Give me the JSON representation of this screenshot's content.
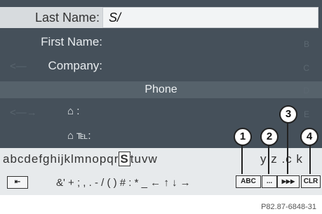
{
  "form": {
    "last_name_label": "Last Name:",
    "last_name_value": "S/",
    "first_name_label": "First Name:",
    "company_label": "Company:",
    "phone_header": "Phone",
    "home_phone_label": "⌂  :",
    "home_fax_label": "⌂ ℡:"
  },
  "keyboard": {
    "letters_before": "abcdefghijklmnopqr",
    "selected_letter": "S",
    "letters_after": "tuvw",
    "letters_tail": "y z .c k",
    "symbols": "&' + ; , . - / ( ) # : * _ ← ↑ ↓ →",
    "back_key": "⇤",
    "abc_key": "ABC",
    "more_key": "...",
    "list_key": "▶▶▶",
    "clear_key": "CLR"
  },
  "callouts": [
    "1",
    "2",
    "3",
    "4"
  ],
  "reference_code": "P82.87-6848-31",
  "icons": {
    "home_phone": "house-phone-icon",
    "home_fax": "house-fax-icon",
    "back": "back-arrow-icon"
  }
}
